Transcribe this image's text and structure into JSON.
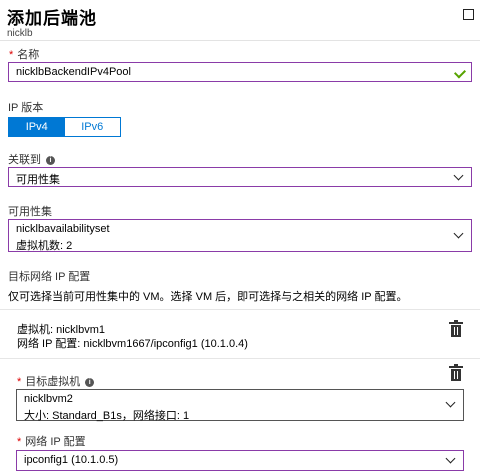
{
  "panel": {
    "title": "添加后端池",
    "subtitle": "nicklb"
  },
  "name_field": {
    "label": "名称",
    "value": "nicklbBackendIPv4Pool"
  },
  "ip_version": {
    "label": "IP 版本",
    "options": [
      "IPv4",
      "IPv6"
    ],
    "selected": "IPv4"
  },
  "associated_to": {
    "label": "关联到",
    "value": "可用性集"
  },
  "availability_set": {
    "label": "可用性集",
    "name": "nicklbavailabilityset",
    "vm_count": "虚拟机数: 2"
  },
  "target_ip_config": {
    "heading": "目标网络 IP 配置",
    "description": "仅可选择当前可用性集中的 VM。选择 VM 后，即可选择与之相关的网络 IP 配置。"
  },
  "existing_vm": {
    "vm_line": "虚拟机: nicklbvm1",
    "ip_line": "网络 IP 配置: nicklbvm1667/ipconfig1 (10.1.0.4)"
  },
  "target_vm": {
    "label": "目标虚拟机",
    "name": "nicklbvm2",
    "detail": "大小: Standard_B1s，网络接口: 1"
  },
  "network_ip_config": {
    "label": "网络 IP 配置",
    "value": "ipconfig1 (10.1.0.5)"
  },
  "colors": {
    "accent": "#0078d4",
    "field_focus": "#8a3ba8",
    "valid_check": "#57a300",
    "required": "#d00000"
  }
}
